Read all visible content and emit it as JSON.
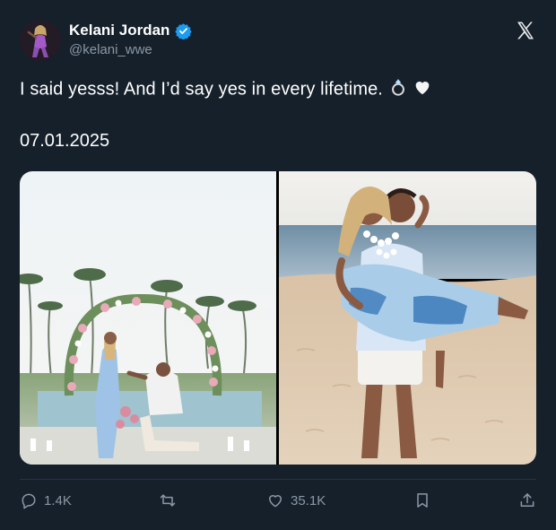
{
  "author": {
    "display_name": "Kelani Jordan",
    "handle": "@kelani_wwe",
    "verified": true,
    "avatar": "profile-photo"
  },
  "brand": {
    "logo": "x-logo-icon"
  },
  "tweet": {
    "text": "I said yesss! And I’d say yes in every lifetime.",
    "emojis": [
      "ring-emoji",
      "white-heart-emoji"
    ],
    "date": "07.01.2025"
  },
  "media": {
    "photos": [
      {
        "id": "proposal-photo",
        "description_icon": "photo"
      },
      {
        "id": "beach-carry-photo",
        "description_icon": "photo"
      }
    ]
  },
  "actions": {
    "reply": {
      "icon": "reply-icon",
      "count": "1.4K"
    },
    "retweet": {
      "icon": "retweet-icon"
    },
    "like": {
      "icon": "heart-icon",
      "count": "35.1K"
    },
    "bookmark": {
      "icon": "bookmark-icon"
    },
    "share": {
      "icon": "share-icon"
    }
  },
  "colors": {
    "background": "#15202b",
    "text_primary": "#ffffff",
    "text_secondary": "#8b98a5",
    "verified_blue": "#1d9bf0",
    "divider": "#2f3336"
  }
}
